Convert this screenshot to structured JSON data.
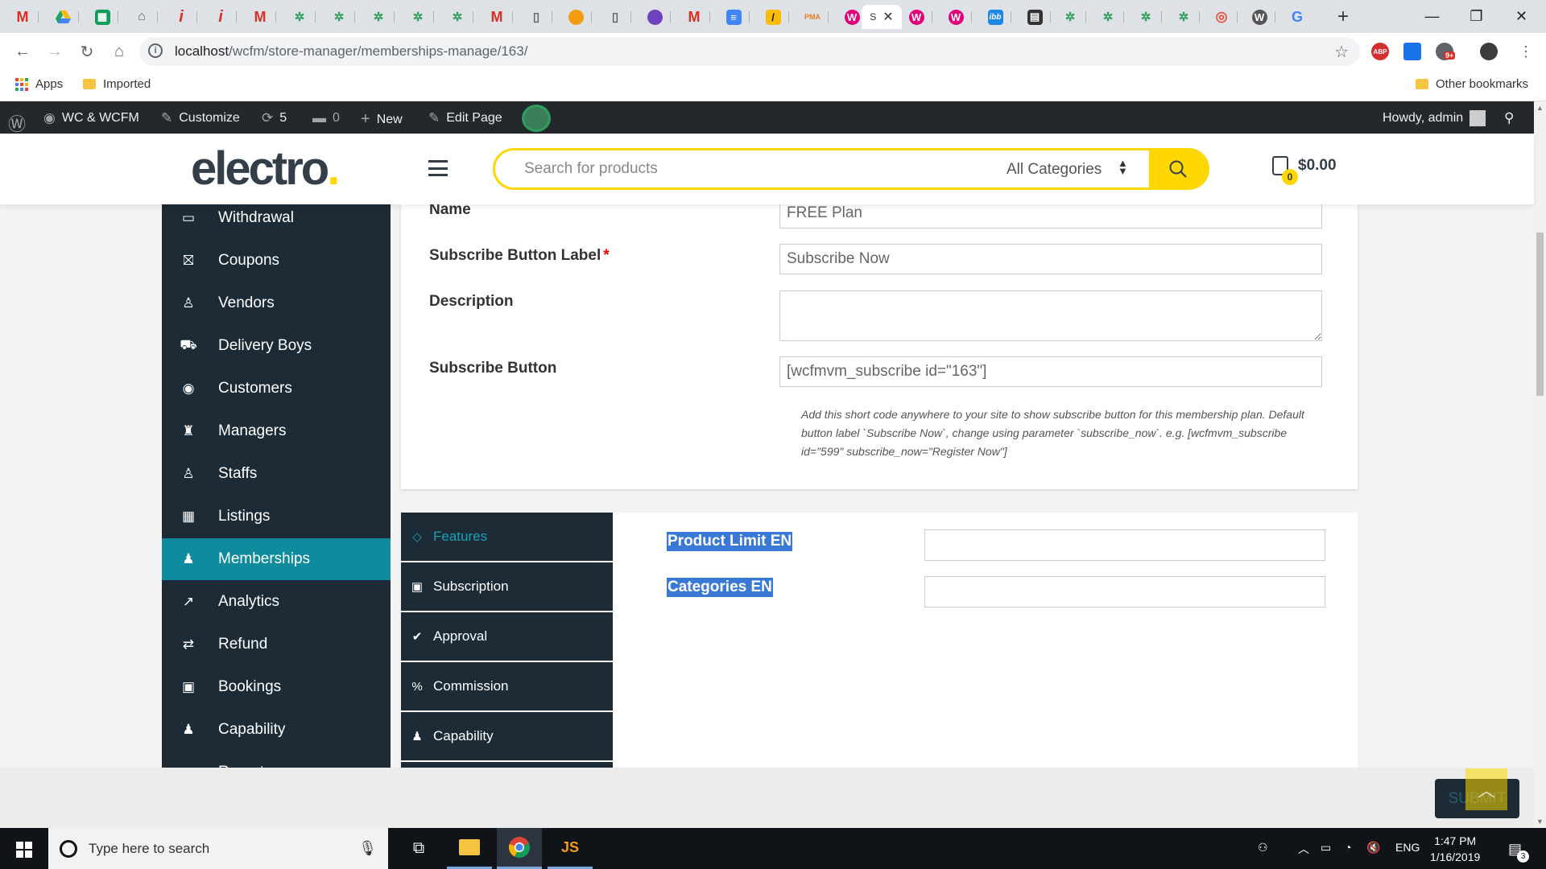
{
  "browser": {
    "active_tab_title": "S",
    "url_host": "localhost",
    "url_path": "/wcfm/store-manager/memberships-manage/163/",
    "abp_label": "ABP",
    "notif_count": "9+"
  },
  "bookmarks": {
    "apps": "Apps",
    "imported": "Imported",
    "other": "Other bookmarks"
  },
  "wpbar": {
    "site": "WC & WCFM",
    "customize": "Customize",
    "updates": "5",
    "comments": "0",
    "new": "New",
    "edit_page": "Edit Page",
    "howdy": "Howdy, admin"
  },
  "header": {
    "logo": "electro",
    "logo_dot": ".",
    "search_placeholder": "Search for products",
    "category": "All Categories",
    "cart_count": "0",
    "cart_total": "$0.00"
  },
  "sidebar": {
    "items": [
      {
        "label": "Withdrawal",
        "icon": "withdrawal-icon"
      },
      {
        "label": "Coupons",
        "icon": "gift-icon"
      },
      {
        "label": "Vendors",
        "icon": "user-icon"
      },
      {
        "label": "Delivery Boys",
        "icon": "truck-icon"
      },
      {
        "label": "Customers",
        "icon": "user-circle-icon"
      },
      {
        "label": "Managers",
        "icon": "manager-icon"
      },
      {
        "label": "Staffs",
        "icon": "user-icon"
      },
      {
        "label": "Listings",
        "icon": "briefcase-icon"
      },
      {
        "label": "Memberships",
        "icon": "user-plus-icon"
      },
      {
        "label": "Analytics",
        "icon": "chart-line-icon"
      },
      {
        "label": "Refund",
        "icon": "retweet-icon"
      },
      {
        "label": "Bookings",
        "icon": "calendar-check-icon"
      },
      {
        "label": "Capability",
        "icon": "user-times-icon"
      },
      {
        "label": "Reports",
        "icon": "pie-chart-icon"
      }
    ],
    "active": "Memberships"
  },
  "form": {
    "name_label": "Name",
    "name_value": "FREE Plan",
    "subscribe_label_label": "Subscribe Button Label",
    "required_mark": "*",
    "subscribe_label_value": "Subscribe Now",
    "description_label": "Description",
    "description_value": "",
    "subscribe_button_label": "Subscribe Button",
    "subscribe_button_value": "[wcfmvm_subscribe id=\"163\"]",
    "help_text": "Add this short code anywhere to your site to show subscribe button for this membership plan. Default button label `Subscribe Now`, change using parameter `subscribe_now`. e.g. [wcfmvm_subscribe id=\"599\" subscribe_now=\"Register Now\"]"
  },
  "tabs": {
    "features": "Features",
    "subscription": "Subscription",
    "approval": "Approval",
    "commission": "Commission",
    "capability": "Capability"
  },
  "features": {
    "product_limit_label": "Product Limit EN",
    "product_limit_value": "",
    "categories_label": "Categories EN",
    "categories_value": ""
  },
  "footer": {
    "submit": "SUBMIT"
  },
  "taskbar": {
    "search_placeholder": "Type here to search",
    "language": "ENG",
    "time": "1:47 PM",
    "date": "1/16/2019",
    "notification_count": "3"
  }
}
